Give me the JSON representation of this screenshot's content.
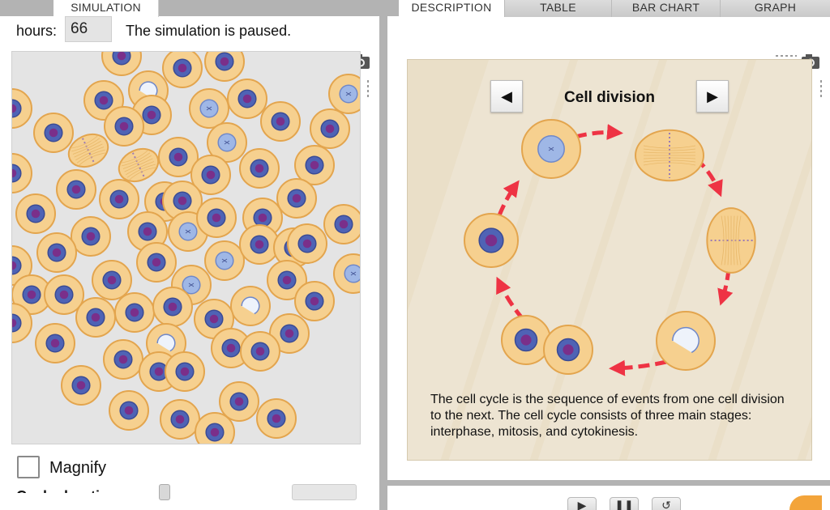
{
  "tabs": {
    "simulation": "SIMULATION",
    "description": "DESCRIPTION",
    "table": "TABLE",
    "bar_chart": "BAR CHART",
    "graph": "GRAPH"
  },
  "sim": {
    "hours_label": "hours:",
    "hours_value": "66",
    "status": "The simulation is paused.",
    "magnify_label": "Magnify",
    "cut_label": "Cycle duration"
  },
  "description": {
    "title": "Cell division",
    "prev_icon": "◀",
    "next_icon": "▶",
    "text": "The cell cycle is the sequence of events from one cell division to the next. The cell cycle consists of three main stages: interphase, mitosis, and cytokinesis."
  },
  "colors": {
    "cell_fill": "#f6d08f",
    "cell_edge": "#e3a54e",
    "nucleus_fill": "#4f63b5",
    "nucleus_core": "#7a2f8a",
    "arrow": "#ee3344",
    "desc_bg": "#eadfc8",
    "accent_orange": "#f3a43a"
  }
}
